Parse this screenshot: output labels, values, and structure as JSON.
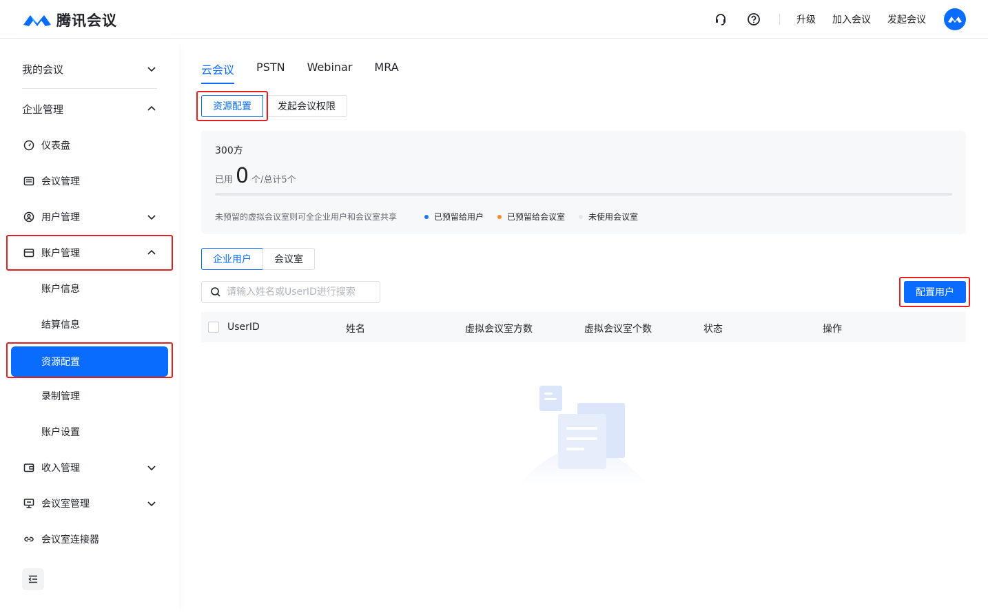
{
  "header": {
    "brand": "腾讯会议",
    "links": [
      "升级",
      "加入会议",
      "发起会议"
    ],
    "icons": [
      "headset-icon",
      "help-icon"
    ]
  },
  "sidebar": {
    "my_meetings": "我的会议",
    "enterprise": "企业管理",
    "items": [
      {
        "label": "仪表盘",
        "icon": "dashboard-icon"
      },
      {
        "label": "会议管理",
        "icon": "list-icon"
      },
      {
        "label": "用户管理",
        "icon": "user-circle-icon"
      },
      {
        "label": "账户管理",
        "icon": "wallet-icon"
      },
      {
        "label": "账户信息"
      },
      {
        "label": "结算信息"
      },
      {
        "label": "资源配置"
      },
      {
        "label": "录制管理"
      },
      {
        "label": "账户设置"
      },
      {
        "label": "收入管理",
        "icon": "income-icon"
      },
      {
        "label": "会议室管理",
        "icon": "monitor-icon"
      },
      {
        "label": "会议室连接器",
        "icon": "link-icon"
      }
    ]
  },
  "main": {
    "tabs": [
      "云会议",
      "PSTN",
      "Webinar",
      "MRA"
    ],
    "sub_tabs": [
      "资源配置",
      "发起会议权限"
    ],
    "usage": {
      "title": "300方",
      "used_prefix": "已用",
      "used_count": "0",
      "used_suffix": "个/总计5个",
      "note": "未预留的虚拟会议室则可全企业用户和会议室共享",
      "legend": [
        {
          "label": "已预留给用户",
          "color": "#1f74ff"
        },
        {
          "label": "已预留给会议室",
          "color": "#ff8a1f"
        },
        {
          "label": "未使用会议室",
          "color": "#e5e6eb"
        }
      ]
    },
    "user_tabs": [
      "企业用户",
      "会议室"
    ],
    "search_placeholder": "请输入姓名或UserID进行搜索",
    "config_button": "配置用户",
    "columns": [
      "UserID",
      "姓名",
      "虚拟会议室方数",
      "虚拟会议室个数",
      "状态",
      "操作"
    ]
  }
}
